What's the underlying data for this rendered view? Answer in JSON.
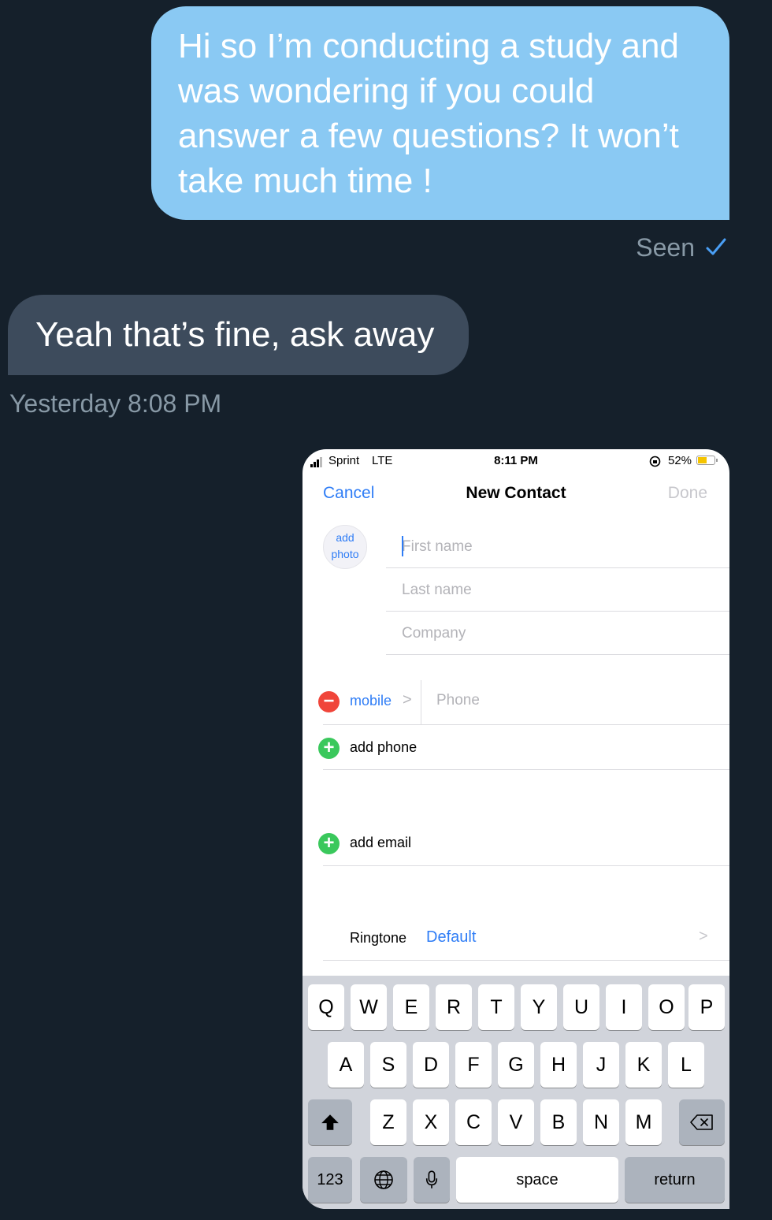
{
  "conversation": {
    "outgoing_message": "Hi so I’m conducting a study and was wondering if you could answer a few questions? It won’t take much time !",
    "seen_label": "Seen",
    "incoming_message": "Yeah that’s fine, ask away",
    "timestamp": "Yesterday 8:08 PM"
  },
  "screenshot": {
    "status_bar": {
      "carrier": "Sprint",
      "network": "LTE",
      "time": "8:11 PM",
      "battery": "52%"
    },
    "nav": {
      "cancel": "Cancel",
      "title": "New Contact",
      "done": "Done"
    },
    "add_photo": [
      "add",
      "photo"
    ],
    "fields": {
      "first_name": "First name",
      "last_name": "Last name",
      "company": "Company"
    },
    "phone_row": {
      "label": "mobile",
      "chevron": ">",
      "placeholder": "Phone"
    },
    "add_phone": "add phone",
    "add_email": "add email",
    "ringtone": {
      "label": "Ringtone",
      "value": "Default",
      "chevron": ">"
    },
    "keyboard": {
      "row1": [
        "Q",
        "W",
        "E",
        "R",
        "T",
        "Y",
        "U",
        "I",
        "O",
        "P"
      ],
      "row2": [
        "A",
        "S",
        "D",
        "F",
        "G",
        "H",
        "J",
        "K",
        "L"
      ],
      "row3": [
        "Z",
        "X",
        "C",
        "V",
        "B",
        "N",
        "M"
      ],
      "numbers_key": "123",
      "space_key": "space",
      "return_key": "return"
    }
  },
  "colors": {
    "background": "#15202b",
    "outgoing_bubble": "#8ac9f3",
    "incoming_bubble": "#3d4b5c",
    "ios_blue": "#2f7df6"
  }
}
